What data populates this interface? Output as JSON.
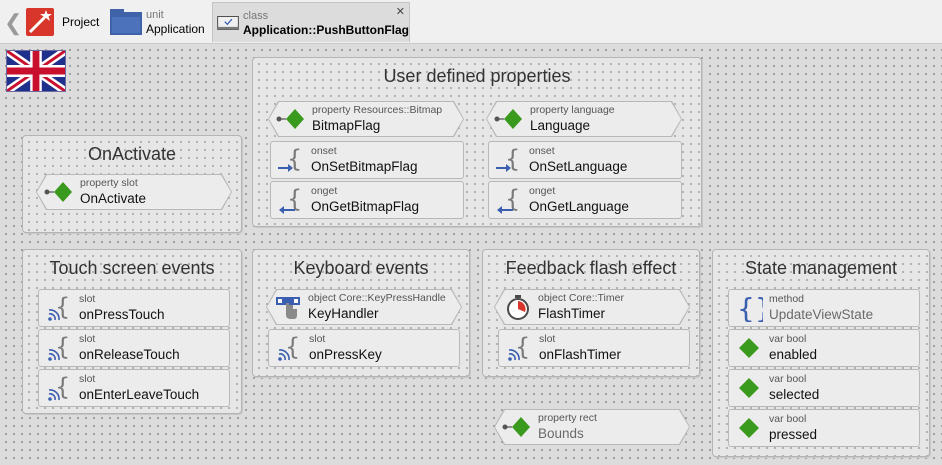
{
  "tabs": [
    {
      "small": "",
      "main": "Project",
      "icon": "project-wand-icon"
    },
    {
      "small": "unit",
      "main": "Application",
      "icon": "folder-icon"
    },
    {
      "small": "class",
      "main": "Application::PushButtonFlag",
      "icon": "class-check-icon"
    }
  ],
  "back_icon": "chevron-left-icon",
  "close_label": "✕",
  "panels": {
    "user_props": "User defined properties",
    "on_activate": "OnActivate",
    "touch": "Touch screen events",
    "keyboard": "Keyboard events",
    "feedback": "Feedback flash effect",
    "state": "State management"
  },
  "members": {
    "bitmap_prop": {
      "k": "property Resources::Bitmap",
      "v": "BitmapFlag"
    },
    "onset_bitmap": {
      "k": "onset",
      "v": "OnSetBitmapFlag"
    },
    "onget_bitmap": {
      "k": "onget",
      "v": "OnGetBitmapFlag"
    },
    "language_prop": {
      "k": "property language",
      "v": "Language"
    },
    "onset_language": {
      "k": "onset",
      "v": "OnSetLanguage"
    },
    "onget_language": {
      "k": "onget",
      "v": "OnGetLanguage"
    },
    "onactivate": {
      "k": "property slot",
      "v": "OnActivate"
    },
    "press_touch": {
      "k": "slot",
      "v": "onPressTouch"
    },
    "release_touch": {
      "k": "slot",
      "v": "onReleaseTouch"
    },
    "enterleave_touch": {
      "k": "slot",
      "v": "onEnterLeaveTouch"
    },
    "key_handler": {
      "k": "object Core::KeyPressHandle",
      "v": "KeyHandler"
    },
    "press_key": {
      "k": "slot",
      "v": "onPressKey"
    },
    "flash_timer": {
      "k": "object Core::Timer",
      "v": "FlashTimer"
    },
    "on_flash_timer": {
      "k": "slot",
      "v": "onFlashTimer"
    },
    "update_view_state": {
      "k": "method",
      "v": "UpdateViewState"
    },
    "enabled": {
      "k": "var bool",
      "v": "enabled"
    },
    "selected": {
      "k": "var bool",
      "v": "selected"
    },
    "pressed": {
      "k": "var bool",
      "v": "pressed"
    },
    "bounds": {
      "k": "property rect",
      "v": "Bounds"
    }
  },
  "colors": {
    "diamond": "#3a9a1e",
    "arrow": "#3a5fb0",
    "brace": "#7a7a7a",
    "wifi": "#3a5fb0"
  }
}
